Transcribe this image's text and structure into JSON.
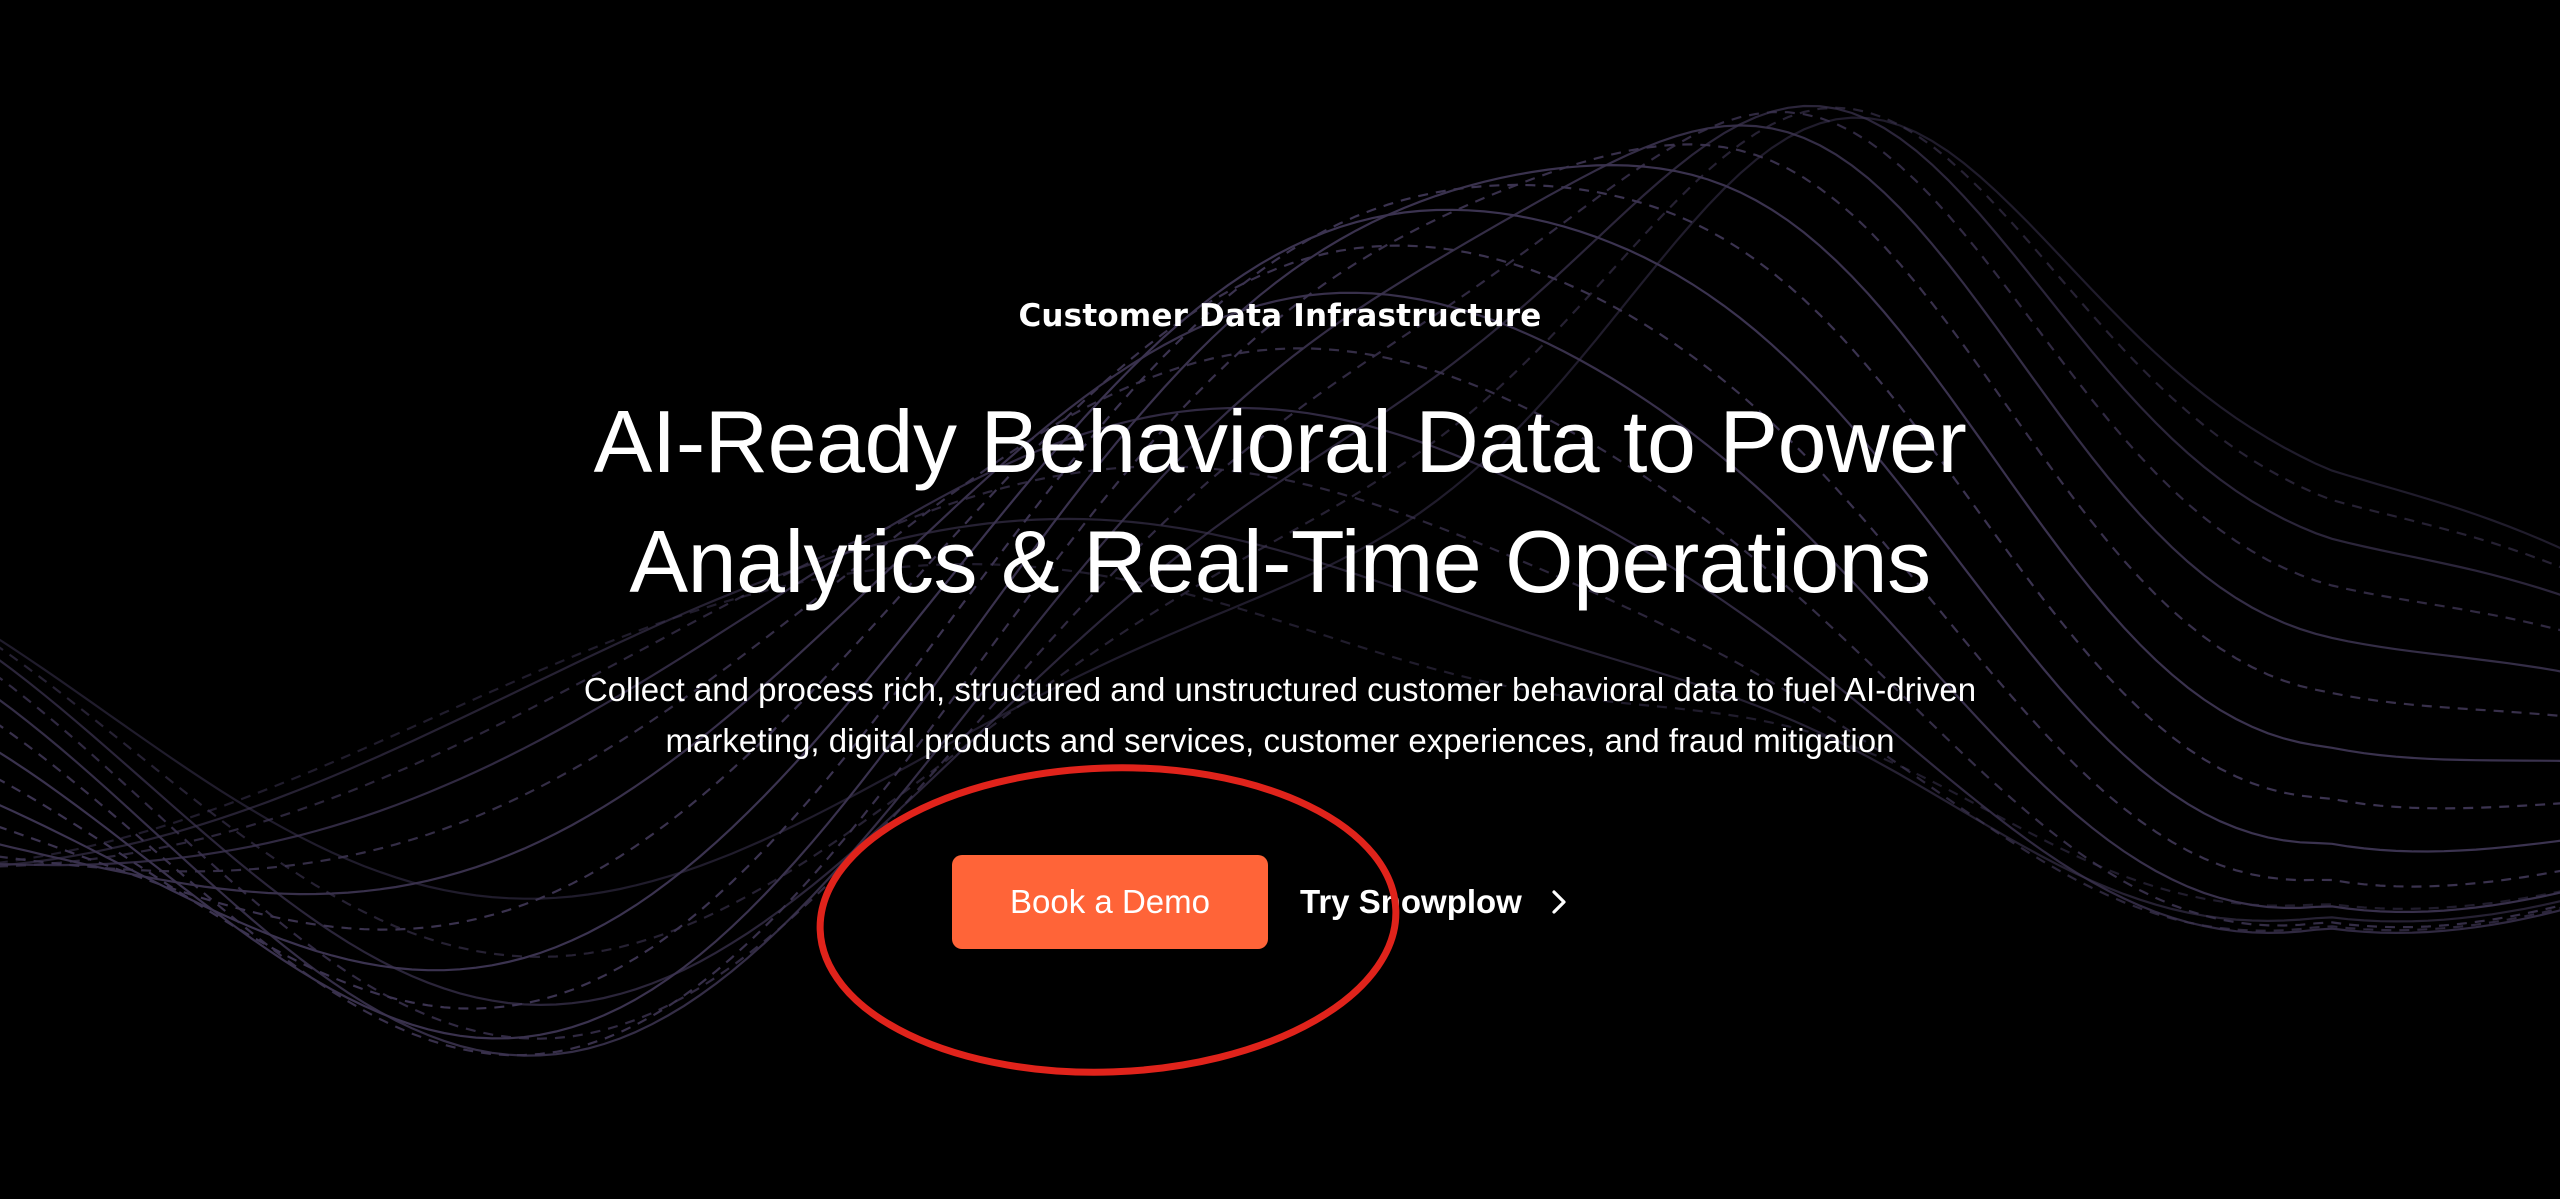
{
  "hero": {
    "eyebrow": "Customer Data Infrastructure",
    "headline_line1": "AI-Ready Behavioral Data to Power",
    "headline_line2": "Analytics & Real-Time Operations",
    "subtitle_line1": "Collect and process rich, structured and unstructured customer behavioral data to fuel AI-driven",
    "subtitle_line2": "marketing, digital products and services, customer experiences, and fraud mitigation"
  },
  "cta": {
    "primary_label": "Book a Demo",
    "secondary_label": "Try Snowplow",
    "secondary_icon": "chevron-right-icon"
  },
  "colors": {
    "background": "#000000",
    "primary_button": "#ff6438",
    "wave_lines": "#3b3350",
    "annotation_ellipse": "#e0231b"
  }
}
